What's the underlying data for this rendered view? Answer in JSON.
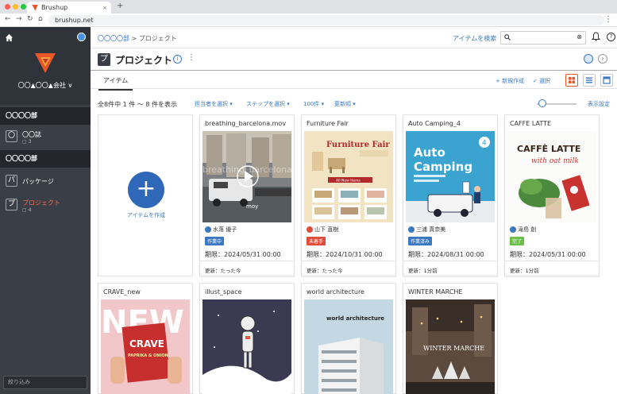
{
  "browser": {
    "tab_title": "Brushup",
    "url": "brushup.net",
    "new_tab": "+",
    "close": "×"
  },
  "sidebar": {
    "company": "〇〇▲〇〇▲会社 ∨",
    "sections": [
      {
        "label": "〇〇〇〇部"
      },
      {
        "label": "〇〇〇〇部"
      }
    ],
    "items": [
      {
        "badge": "〇",
        "label": "〇〇誌",
        "sub": "3"
      },
      {
        "badge": "パ",
        "label": "パッケージ",
        "sub": ""
      },
      {
        "badge": "プ",
        "label": "プロジェクト",
        "sub": "4"
      }
    ],
    "filter_placeholder": "絞り込み"
  },
  "header": {
    "breadcrumb_link": "〇〇〇〇部",
    "breadcrumb_sep": " > ",
    "breadcrumb_current": "プロジェクト",
    "search_label": "アイテムを検索",
    "search_value": ""
  },
  "project": {
    "badge": "プ",
    "title": "プロジェクト",
    "tab": "アイテム",
    "new_label": "+ 新規作成",
    "select_label": "✓ 選択"
  },
  "toolbar": {
    "count": "全8件中 1 件 〜 8 件を表示",
    "assignee_dd": "担当者を選択 ▾",
    "step_dd": "ステップを選択 ▾",
    "per_page_dd": "100件 ▾",
    "sort_dd": "更新順 ▾",
    "display_settings": "表示設定"
  },
  "create_card": {
    "plus": "+",
    "label": "アイテムを作成"
  },
  "cards": [
    {
      "title": "breathing_barcelona.mov",
      "assignee": "水落 優子",
      "status": "作業中",
      "status_color": "#3b78c3",
      "due": "期限：2024/05/31 00:00",
      "updated": "更新：たった今",
      "thumb": "video"
    },
    {
      "title": "Furniture Fair",
      "assignee": "山下 直樹",
      "status": "未着手",
      "status_color": "#e04b3a",
      "due": "期限：2024/10/31 00:00",
      "updated": "更新：たった今",
      "thumb": "furniture"
    },
    {
      "title": "Auto Camping_4",
      "assignee": "三浦 真奈美",
      "status": "作業済み",
      "status_color": "#3b78c3",
      "due": "期限：2024/08/31 00:00",
      "updated": "更新：1分前",
      "thumb": "camping"
    },
    {
      "title": "CAFFE LATTE",
      "assignee": "滝島 創",
      "status": "完了",
      "status_color": "#6bbf4a",
      "due": "期限：2024/05/31 00:00",
      "updated": "更新：1分前",
      "thumb": "latte"
    },
    {
      "title": "CRAVE_new",
      "assignee": "",
      "status": "",
      "status_color": "",
      "due": "",
      "updated": "",
      "thumb": "crave"
    },
    {
      "title": "illust_space",
      "assignee": "",
      "status": "",
      "status_color": "",
      "due": "",
      "updated": "",
      "thumb": "space"
    },
    {
      "title": "world architecture",
      "assignee": "",
      "status": "",
      "status_color": "",
      "due": "",
      "updated": "",
      "thumb": "arch"
    },
    {
      "title": "WINTER MARCHE",
      "assignee": "",
      "status": "",
      "status_color": "",
      "due": "",
      "updated": "",
      "thumb": "winter"
    }
  ],
  "thumb_text": {
    "video_watermark": "breathing_barcelona",
    "video_caption": "moy",
    "furniture_title": "Furniture Fair",
    "furniture_sub": "All New Items",
    "camping_title": "Auto\nCamping",
    "camping_badge": "4",
    "latte_title": "CAFFÈ LATTE",
    "latte_sub": "with oat milk",
    "crave_big": "NEW",
    "crave_pkg": "CRAVE",
    "crave_flavor": "PAPRIKA & ONION",
    "arch_title": "world architecture",
    "winter_title": "WINTER MARCHE"
  },
  "icons": {
    "home": "home-icon",
    "user": "user-icon",
    "search": "search-icon",
    "bell": "bell-icon",
    "help": "help-icon",
    "info": "info-icon",
    "play": "play-icon"
  },
  "colors": {
    "accent": "#3b78c3",
    "sidebar": "#3a3f47",
    "brand_orange": "#e8562a"
  }
}
